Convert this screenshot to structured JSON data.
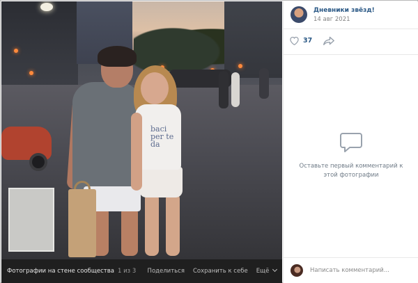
{
  "photo": {
    "shirt_text": "baci per te da"
  },
  "photo_bar": {
    "album": "Фотографии на стене сообщества",
    "counter": "1 из 3",
    "share": "Поделиться",
    "save": "Сохранить к себе",
    "more": "Ещё"
  },
  "author": {
    "name": "Дневники звёзд!",
    "date": "14 авг 2021"
  },
  "actions": {
    "like_count": "37",
    "like_icon": "heart-outline-icon",
    "share_icon": "share-arrow-icon"
  },
  "comments": {
    "empty_icon": "comment-bubble-icon",
    "empty_text": "Оставьте первый комментарий к этой фотографии",
    "input_placeholder": "Написать комментарий..."
  },
  "colors": {
    "link": "#2a5885",
    "muted": "#828282",
    "bar_bg": "#1f1f1f"
  }
}
